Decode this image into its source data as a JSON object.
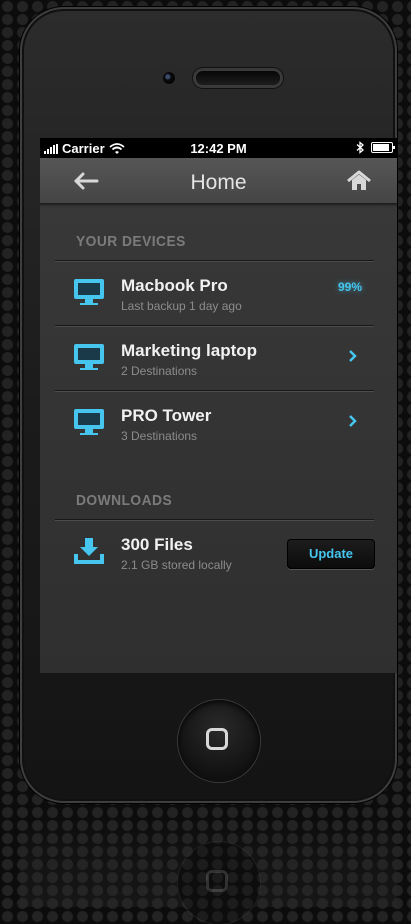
{
  "status_bar": {
    "carrier": "Carrier",
    "time": "12:42 PM"
  },
  "nav": {
    "title": "Home"
  },
  "devices": {
    "header": "YOUR DEVICES",
    "items": [
      {
        "name": "Macbook Pro",
        "detail": "Last backup 1 day ago",
        "progress": "99%"
      },
      {
        "name": "Marketing laptop",
        "detail": "2 Destinations"
      },
      {
        "name": "PRO Tower",
        "detail": "3 Destinations"
      }
    ]
  },
  "downloads": {
    "header": "DOWNLOADS",
    "item": {
      "name": "300 Files",
      "detail": "2.1 GB stored locally",
      "button": "Update"
    }
  },
  "colors": {
    "accent": "#46c6ef",
    "nav_bar": "#4e4e4e",
    "screen_bg": "#333333"
  },
  "icons": [
    "signal-icon",
    "wifi-icon",
    "bluetooth-icon",
    "battery-icon",
    "back-arrow-icon",
    "home-icon",
    "monitor-icon",
    "chevron-right-icon",
    "download-icon"
  ]
}
